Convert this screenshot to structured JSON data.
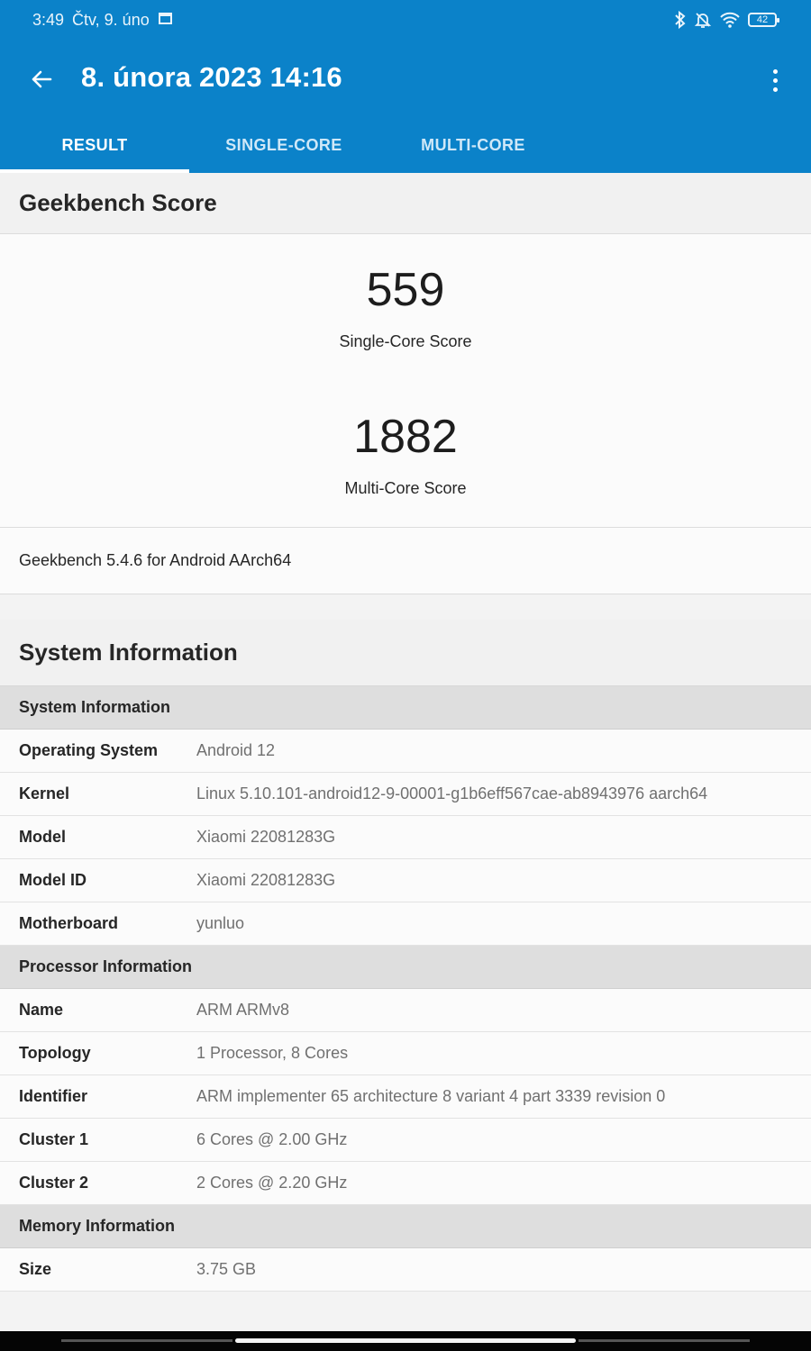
{
  "status_bar": {
    "time": "3:49",
    "date": "Čtv, 9. úno",
    "battery": "42"
  },
  "toolbar": {
    "title": "8. února 2023 14:16"
  },
  "tabs": [
    {
      "label": "RESULT",
      "active": true
    },
    {
      "label": "SINGLE-CORE",
      "active": false
    },
    {
      "label": "MULTI-CORE",
      "active": false
    }
  ],
  "score_section": {
    "heading": "Geekbench Score",
    "single_core": {
      "value": "559",
      "label": "Single-Core Score"
    },
    "multi_core": {
      "value": "1882",
      "label": "Multi-Core Score"
    },
    "version": "Geekbench 5.4.6 for Android AArch64"
  },
  "system_section": {
    "heading": "System Information",
    "groups": [
      {
        "title": "System Information",
        "rows": [
          {
            "key": "Operating System",
            "value": "Android 12"
          },
          {
            "key": "Kernel",
            "value": "Linux 5.10.101-android12-9-00001-g1b6eff567cae-ab8943976 aarch64"
          },
          {
            "key": "Model",
            "value": "Xiaomi 22081283G"
          },
          {
            "key": "Model ID",
            "value": "Xiaomi 22081283G"
          },
          {
            "key": "Motherboard",
            "value": "yunluo"
          }
        ]
      },
      {
        "title": "Processor Information",
        "rows": [
          {
            "key": "Name",
            "value": "ARM ARMv8"
          },
          {
            "key": "Topology",
            "value": "1 Processor, 8 Cores"
          },
          {
            "key": "Identifier",
            "value": "ARM implementer 65 architecture 8 variant 4 part 3339 revision 0"
          },
          {
            "key": "Cluster 1",
            "value": "6 Cores @ 2.00 GHz"
          },
          {
            "key": "Cluster 2",
            "value": "2 Cores @ 2.20 GHz"
          }
        ]
      },
      {
        "title": "Memory Information",
        "rows": [
          {
            "key": "Size",
            "value": "3.75 GB"
          }
        ]
      }
    ]
  },
  "colors": {
    "app_bar": "#0b82c9",
    "group_header": "#dedede",
    "row_background": "#fbfbfb"
  }
}
